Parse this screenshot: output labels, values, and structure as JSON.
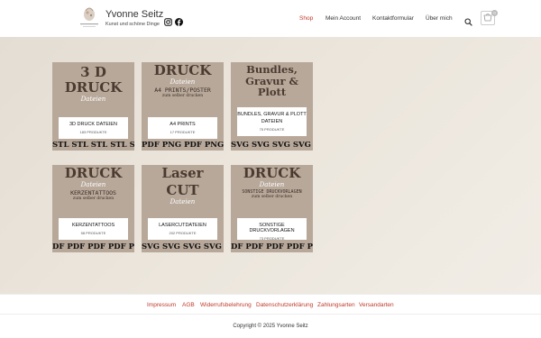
{
  "site": {
    "title": "Yvonne Seitz",
    "tagline": "Kunst und schöne Dinge"
  },
  "nav": {
    "items": [
      "Shop",
      "Mein Account",
      "Kontaktformular",
      "Über mich"
    ],
    "active": "Shop"
  },
  "cart": {
    "count": "0"
  },
  "categories": [
    {
      "image_lines": [
        "3 D",
        "DRUCK"
      ],
      "image_sub": "Dateien",
      "image_strip": "STL STL STL STL STL STL STL",
      "name": "3D DRUCK DATEIEN",
      "count": "183 PRODUKTE"
    },
    {
      "image_lines": [
        "DRUCK"
      ],
      "image_sub": "Dateien",
      "image_extra": "A4 PRINTS/POSTER",
      "image_small": "zum selber drucken",
      "image_strip": "PDF PNG PDF PNG PDF PNG PDF",
      "name": "A4 PRINTS",
      "count": "17 PRODUKTE"
    },
    {
      "image_lines": [
        "Bundles,",
        "Gravur &",
        "Plott"
      ],
      "image_strip": "SVG SVG SVG SVG SVG SVG SVG",
      "name": "BUNDLES, GRAVUR & PLOTT DATEIEN",
      "count": "75 PRODUKTE"
    },
    {
      "image_lines": [
        "DRUCK"
      ],
      "image_sub": "Dateien",
      "image_extra": "KERZENTATTOOS",
      "image_small": "zum selber drucken",
      "image_strip": "DF PDF PDF PDF PDF PDF PDF PDF",
      "name": "KERZENTATTOOS",
      "count": "58 PRODUKTE"
    },
    {
      "image_lines": [
        "Laser",
        "CUT"
      ],
      "image_sub": "Dateien",
      "image_strip": "SVG SVG SVG SVG SVG SVG SVG",
      "name": "LASERCUTDATEIEN",
      "count": "202 PRODUKTE"
    },
    {
      "image_lines": [
        "DRUCK"
      ],
      "image_sub": "Dateien",
      "image_extra": "SONSTIGE DRUCKVORLAGEN",
      "image_small": "zum selber drucken",
      "image_strip": "DF PDF PDF PDF PDF PDF PDF PDF",
      "name": "SONSTIGE DRUCKVORLAGEN",
      "count": "73 PRODUKTE"
    }
  ],
  "footer": {
    "links": [
      "Impressum",
      "AGB",
      "Widerrufsbelehrung",
      "Datenschutzerklärung",
      "Zahlungsarten",
      "Versandarten"
    ],
    "copyright": "Copyright © 2025 Yvonne Seitz"
  },
  "colors": {
    "accent": "#c0392b",
    "card_bg": "#b8a89a",
    "card_text": "#4a3a30"
  }
}
